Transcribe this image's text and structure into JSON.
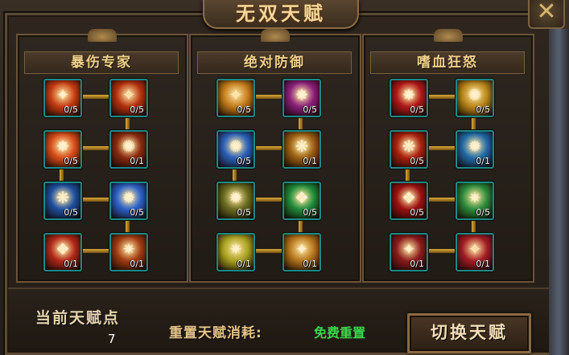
{
  "title": "无双天赋",
  "close_icon": "close-x-icon",
  "panels": [
    {
      "title": "暴伤专家",
      "skills": [
        {
          "level": "0/5",
          "icon": "fire-warrior-icon",
          "color": "#c43a10"
        },
        {
          "level": "0/5",
          "icon": "flame-slash-icon",
          "color": "#b3300c"
        },
        {
          "level": "0/5",
          "icon": "fire-burst-icon",
          "color": "#d44a18"
        },
        {
          "level": "0/1",
          "icon": "spark-strike-icon",
          "color": "#8a2a10"
        },
        {
          "level": "0/5",
          "icon": "blue-figure-icon",
          "color": "#1d4fa0"
        },
        {
          "level": "0/5",
          "icon": "lightning-claw-icon",
          "color": "#2a60c8"
        },
        {
          "level": "0/1",
          "icon": "flame-heart-icon",
          "color": "#b02818"
        },
        {
          "level": "0/1",
          "icon": "fire-knight-icon",
          "color": "#a03a12"
        }
      ]
    },
    {
      "title": "绝对防御",
      "skills": [
        {
          "level": "0/5",
          "icon": "amber-shield-icon",
          "color": "#c27a1a"
        },
        {
          "level": "0/5",
          "icon": "violet-blade-icon",
          "color": "#8a1f7a"
        },
        {
          "level": "0/5",
          "icon": "blue-shield-icon",
          "color": "#2a60b8"
        },
        {
          "level": "0/1",
          "icon": "golden-ring-icon",
          "color": "#9a5e12"
        },
        {
          "level": "0/5",
          "icon": "storm-orb-icon",
          "color": "#6a6a20"
        },
        {
          "level": "0/5",
          "icon": "green-aura-icon",
          "color": "#1f8a3a"
        },
        {
          "level": "0/1",
          "icon": "gold-wings-icon",
          "color": "#a8a020"
        },
        {
          "level": "0/1",
          "icon": "gold-monk-icon",
          "color": "#b4741a"
        }
      ]
    },
    {
      "title": "嗜血狂怒",
      "skills": [
        {
          "level": "0/5",
          "icon": "blood-eye-icon",
          "color": "#b01818"
        },
        {
          "level": "0/5",
          "icon": "golden-sword-icon",
          "color": "#b8861a"
        },
        {
          "level": "0/5",
          "icon": "rage-figure-icon",
          "color": "#a8200e"
        },
        {
          "level": "0/1",
          "icon": "ice-spear-icon",
          "color": "#1f6aa8"
        },
        {
          "level": "0/5",
          "icon": "demon-mask-icon",
          "color": "#9a1010"
        },
        {
          "level": "0/5",
          "icon": "green-vine-icon",
          "color": "#2a8a3a"
        },
        {
          "level": "0/1",
          "icon": "crimson-dragon-icon",
          "color": "#8a1a1a"
        },
        {
          "level": "0/1",
          "icon": "red-totem-icon",
          "color": "#a31c24"
        }
      ]
    }
  ],
  "footer": {
    "points_label": "当前天赋点",
    "points_value": "7",
    "reset_label": "重置天赋消耗:",
    "reset_value": "免费重置",
    "switch_label": "切换天赋"
  }
}
